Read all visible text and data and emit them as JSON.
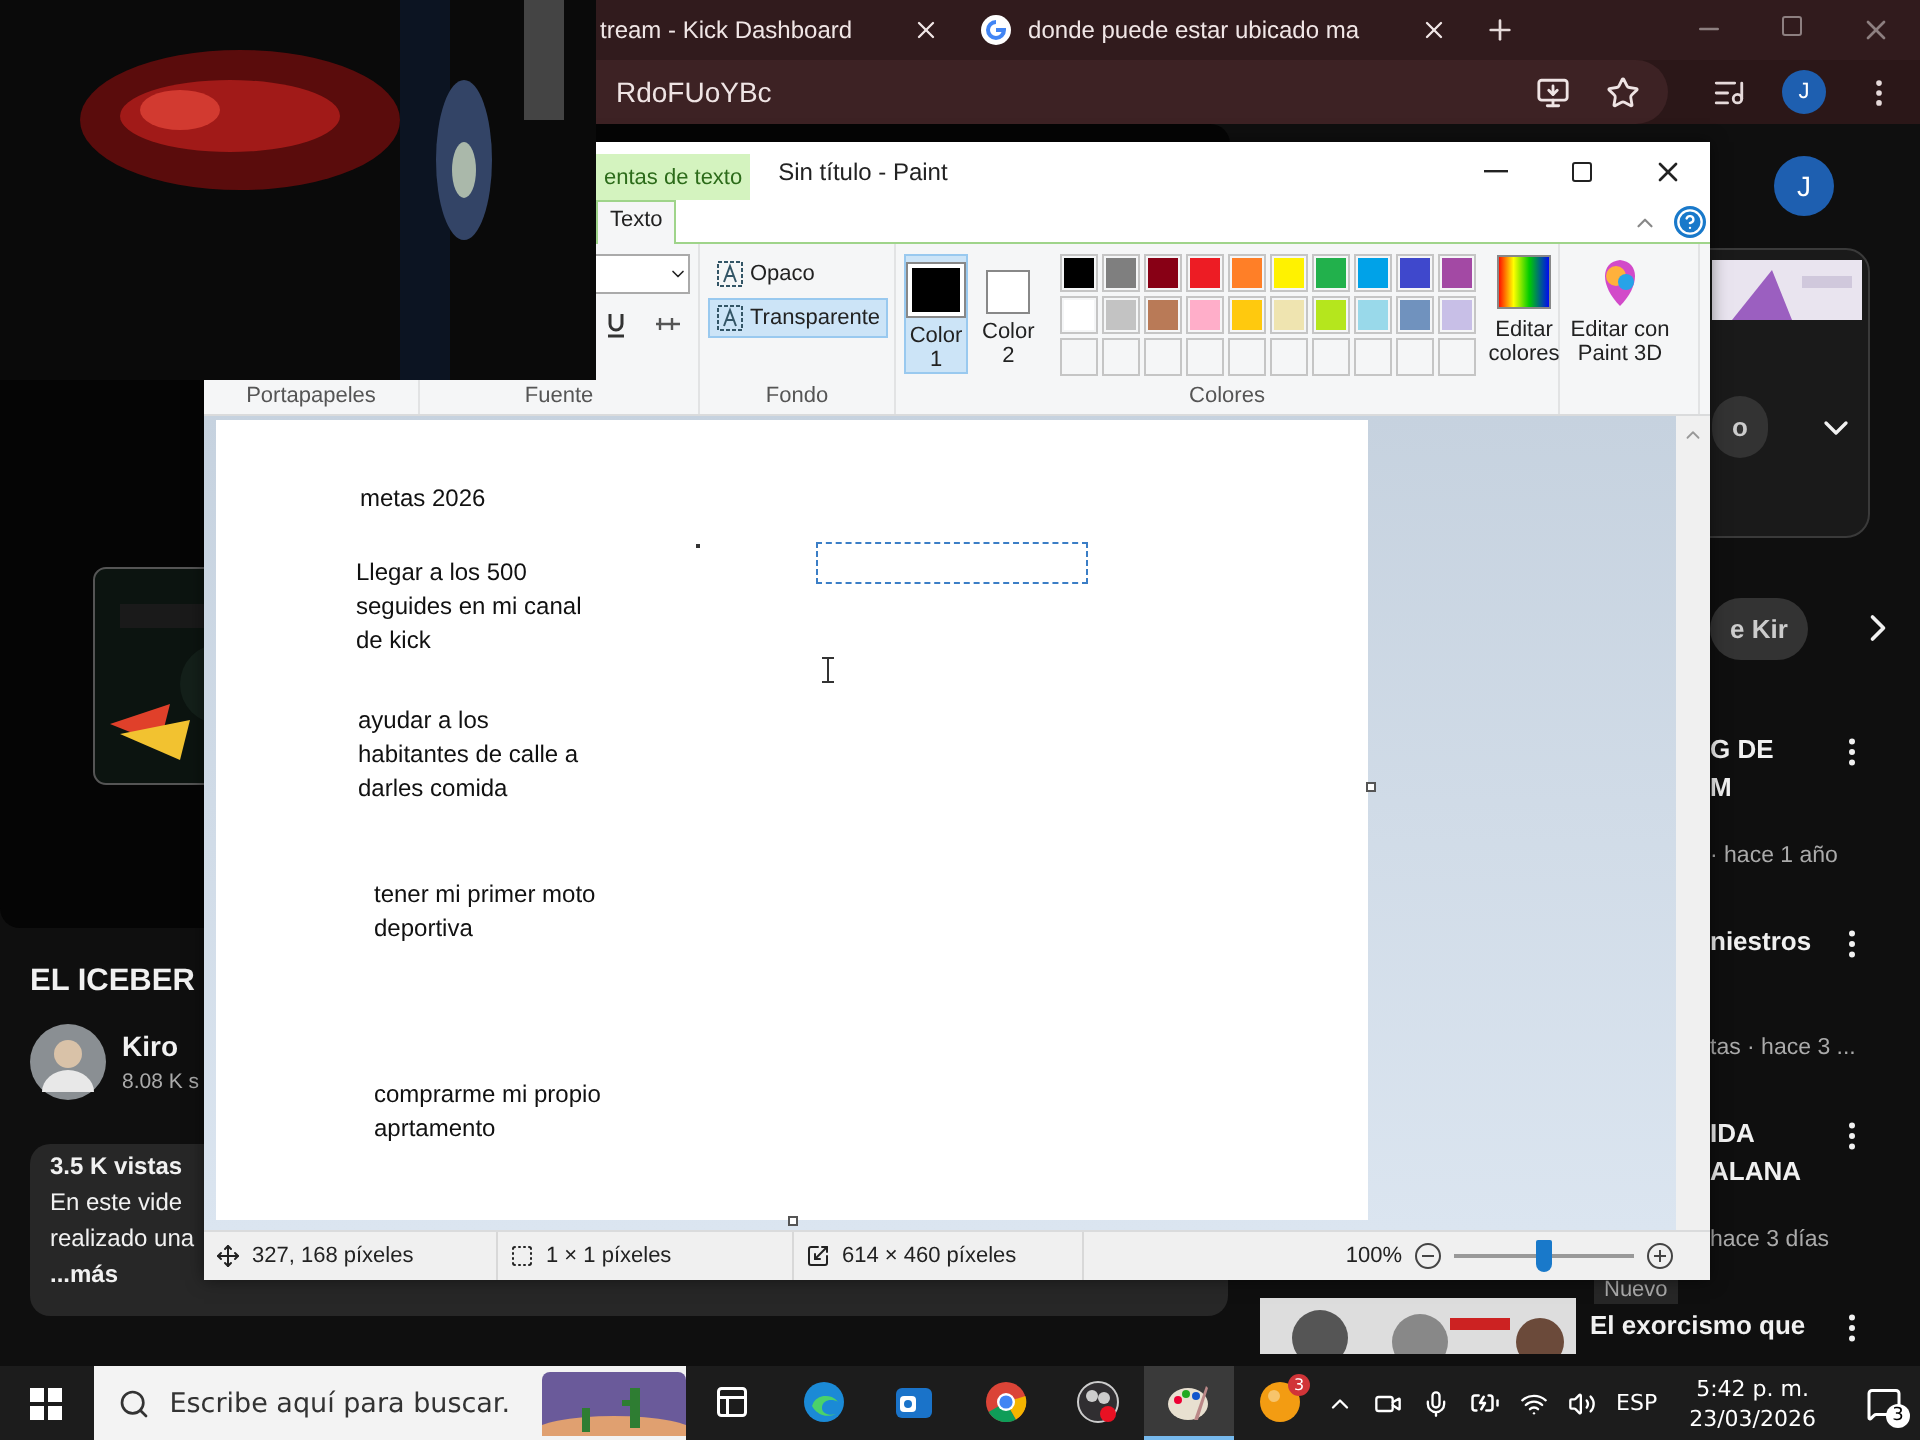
{
  "browser": {
    "tabs": [
      {
        "title": "tream - Kick Dashboard",
        "kind": "plain"
      },
      {
        "title": "donde puede estar ubicado ma",
        "kind": "google"
      }
    ],
    "address": "RdoFUoYBc",
    "profile": "J"
  },
  "youtube": {
    "title": "EL ICEBER",
    "channel": "Kiro",
    "subscribers": "8.08 K s",
    "views": "3.5 K vistas",
    "description": [
      "En este vide",
      "realizado una"
    ],
    "more": "...más",
    "account": "J",
    "chips": [
      "o",
      "e Kir"
    ],
    "related": [
      {
        "kind": "partial",
        "lines": [
          "G DE",
          "M"
        ],
        "meta": "· hace 1 año"
      },
      {
        "kind": "partial",
        "lines": [
          "niestros"
        ],
        "meta": "tas · hace 3 ..."
      },
      {
        "kind": "partial",
        "lines": [
          "IDA",
          "ALANA"
        ],
        "meta": "hace 3 días",
        "badge": "Nuevo"
      },
      {
        "kind": "full",
        "lines": [
          "El exorcismo que"
        ]
      }
    ]
  },
  "paint": {
    "title": "Sin título - Paint",
    "context_tab": "entas de texto",
    "tabs": [
      {
        "label": "Texto",
        "selected": true
      }
    ],
    "background": [
      {
        "label": "Opaco",
        "selected": false
      },
      {
        "label": "Transparente",
        "selected": true
      }
    ],
    "colors": [
      {
        "label": "Color 1",
        "color": "#000000",
        "selected": true
      },
      {
        "label": "Color 2",
        "color": "#ffffff",
        "selected": false
      }
    ],
    "palette": [
      {
        "kind": "color",
        "color": "#000000"
      },
      {
        "kind": "color",
        "color": "#7f7f7f"
      },
      {
        "kind": "color",
        "color": "#880015"
      },
      {
        "kind": "color",
        "color": "#ed1c24"
      },
      {
        "kind": "color",
        "color": "#ff7f27"
      },
      {
        "kind": "color",
        "color": "#fff200"
      },
      {
        "kind": "color",
        "color": "#22b14c"
      },
      {
        "kind": "color",
        "color": "#00a2e8"
      },
      {
        "kind": "color",
        "color": "#3f48cc"
      },
      {
        "kind": "color",
        "color": "#a349a4"
      },
      {
        "kind": "color",
        "color": "#ffffff"
      },
      {
        "kind": "color",
        "color": "#c3c3c3"
      },
      {
        "kind": "color",
        "color": "#b97a57"
      },
      {
        "kind": "color",
        "color": "#ffaec9"
      },
      {
        "kind": "color",
        "color": "#ffc90e"
      },
      {
        "kind": "color",
        "color": "#efe4b0"
      },
      {
        "kind": "color",
        "color": "#b5e61d"
      },
      {
        "kind": "color",
        "color": "#99d9ea"
      },
      {
        "kind": "color",
        "color": "#7092be"
      },
      {
        "kind": "color",
        "color": "#c8bfe7"
      },
      {
        "kind": "empty"
      },
      {
        "kind": "empty"
      },
      {
        "kind": "empty"
      },
      {
        "kind": "empty"
      },
      {
        "kind": "empty"
      },
      {
        "kind": "empty"
      },
      {
        "kind": "empty"
      },
      {
        "kind": "empty"
      },
      {
        "kind": "empty"
      },
      {
        "kind": "empty"
      }
    ],
    "edit_colors": "Editar colores",
    "paint3d": "Editar con Paint 3D",
    "groups": [
      "Portapapeles",
      "Fuente",
      "Fondo",
      "Colores"
    ],
    "canvas_texts": [
      {
        "text": "metas 2026"
      },
      {
        "text": "Llegar a los 500 seguides en mi canal de kick"
      },
      {
        "text": "ayudar a los habitantes de calle a darles comida"
      },
      {
        "text": "tener mi primer moto deportiva"
      },
      {
        "text": "comprarme mi propio aprtamento"
      }
    ],
    "status": {
      "cursor": "327, 168 píxeles",
      "selection": "1 × 1 píxeles",
      "size": "614 × 460 píxeles",
      "zoom": "100%",
      "level": 0.5
    }
  },
  "taskbar": {
    "search": "Escribe aquí para buscar.",
    "apps": [
      {
        "kind": "taskview",
        "active": false
      },
      {
        "kind": "edge",
        "active": false
      },
      {
        "kind": "outlook",
        "active": false
      },
      {
        "kind": "chrome",
        "active": false
      },
      {
        "kind": "obs",
        "active": false
      },
      {
        "kind": "paint",
        "active": true
      },
      {
        "kind": "orange",
        "active": false,
        "badge": "3"
      }
    ],
    "language": "ESP",
    "time": "5:42 p. m.",
    "date": "23/03/2026",
    "notifications": "3"
  }
}
